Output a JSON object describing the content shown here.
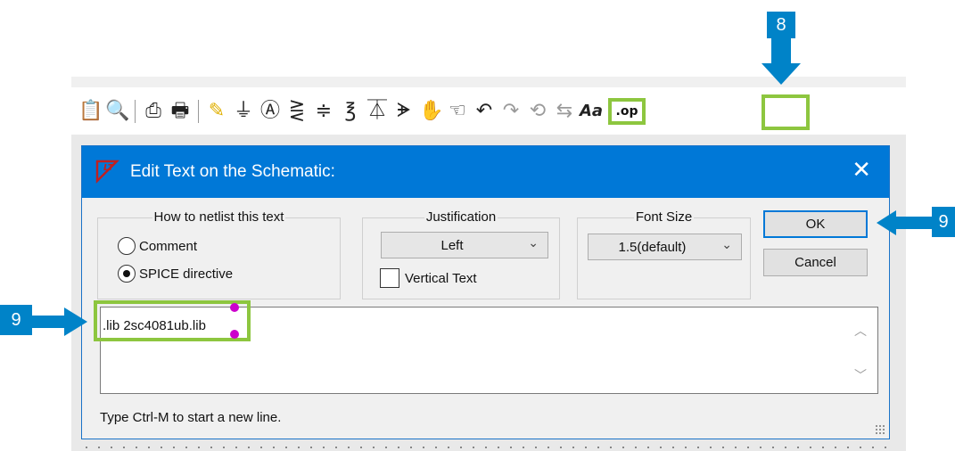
{
  "annotations": {
    "marker_top": "8",
    "marker_right": "9",
    "marker_left": "9",
    "accent": "#0083c8",
    "highlight": "#8dc63f"
  },
  "toolbar": {
    "icons": [
      "paste-icon",
      "find-icon",
      "print-preview-icon",
      "print-icon",
      "draw-wire-icon",
      "ground-icon",
      "label-net-icon",
      "resistor-icon",
      "capacitor-icon",
      "inductor-icon",
      "diode-icon",
      "component-icon",
      "move-icon",
      "drag-icon",
      "undo-icon",
      "redo-icon",
      "rotate-icon",
      "mirror-icon",
      "text-icon"
    ],
    "spice_directive_label": ".op"
  },
  "dialog": {
    "title": "Edit Text on the Schematic:",
    "netlist_group": {
      "legend": "How to netlist this text",
      "options": [
        "Comment",
        "SPICE directive"
      ],
      "selected": "SPICE directive"
    },
    "justification_group": {
      "legend": "Justification",
      "selected": "Left",
      "vertical_text_label": "Vertical Text",
      "vertical_text_checked": false
    },
    "font_size_group": {
      "legend": "Font Size",
      "selected": "1.5(default)"
    },
    "ok_label": "OK",
    "cancel_label": "Cancel",
    "text_value": ".lib 2sc4081ub.lib",
    "hint": "Type Ctrl-M to start a new line."
  }
}
